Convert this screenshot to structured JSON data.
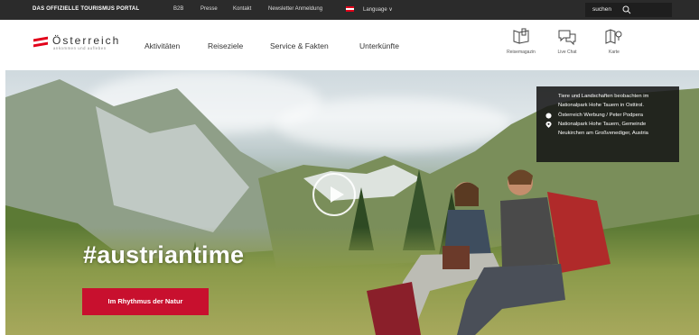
{
  "topbar": {
    "portal_label": "DAS OFFIZIELLE TOURISMUS PORTAL",
    "links": [
      "B2B",
      "Presse",
      "Kontakt",
      "Newsletter Anmeldung"
    ],
    "language_label": "Language ∨",
    "search_label": "suchen"
  },
  "logo": {
    "name": "Österreich",
    "tagline": "ankommen und aufleben"
  },
  "nav": {
    "items": [
      "Aktivitäten",
      "Reiseziele",
      "Service & Fakten",
      "Unterkünfte"
    ]
  },
  "tools": [
    {
      "label": "Reisemagazin",
      "icon": "magazine-icon"
    },
    {
      "label": "Live Chat",
      "icon": "chat-icon"
    },
    {
      "label": "Karte",
      "icon": "map-icon"
    }
  ],
  "hero": {
    "hashtag": "#austriantime",
    "cta_label": "Im Rhythmus der Natur",
    "info": {
      "title": "Tiere und Landschaften beobachten im Nationalpark Hohe Tauern in Osttirol.",
      "credit": "Österreich Werbung / Peter Podpera",
      "location": "Nationalpark Hohe Tauern, Gemeinde Neukirchen am Großvenediger, Austria"
    }
  },
  "colors": {
    "brand_red": "#c8102e",
    "topbar_bg": "#2b2b2b"
  }
}
